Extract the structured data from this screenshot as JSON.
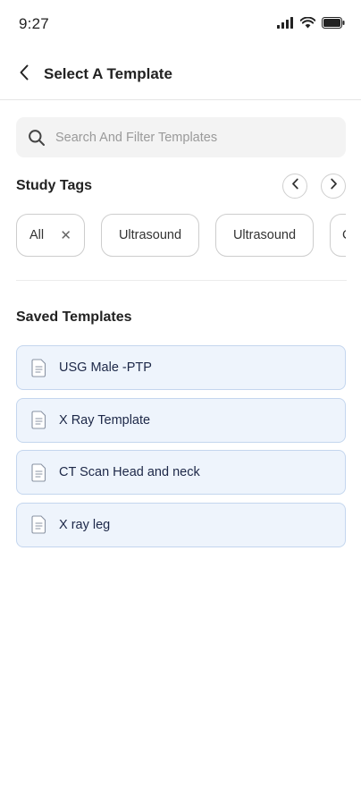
{
  "status_bar": {
    "time": "9:27"
  },
  "header": {
    "title": "Select A Template",
    "back_icon": "chevron-left-icon"
  },
  "search": {
    "placeholder": "Search And Filter Templates",
    "value": "",
    "icon": "search-icon"
  },
  "study_tags": {
    "title": "Study Tags",
    "prev_icon": "chevron-left-icon",
    "next_icon": "chevron-right-icon",
    "chips": [
      {
        "label": "All",
        "removable": true
      },
      {
        "label": "Ultrasound"
      },
      {
        "label": "Ultrasound"
      },
      {
        "label": "C"
      }
    ]
  },
  "saved_templates": {
    "title": "Saved Templates",
    "items": [
      {
        "name": "USG Male -PTP",
        "icon": "document-icon"
      },
      {
        "name": "X Ray Template",
        "icon": "document-icon"
      },
      {
        "name": "CT Scan Head and neck",
        "icon": "document-icon"
      },
      {
        "name": "X ray leg",
        "icon": "document-icon"
      }
    ]
  },
  "colors": {
    "card_background": "#eef4fc",
    "card_border": "#c4d6ee",
    "search_background": "#f3f3f3",
    "text_primary": "#222222"
  }
}
